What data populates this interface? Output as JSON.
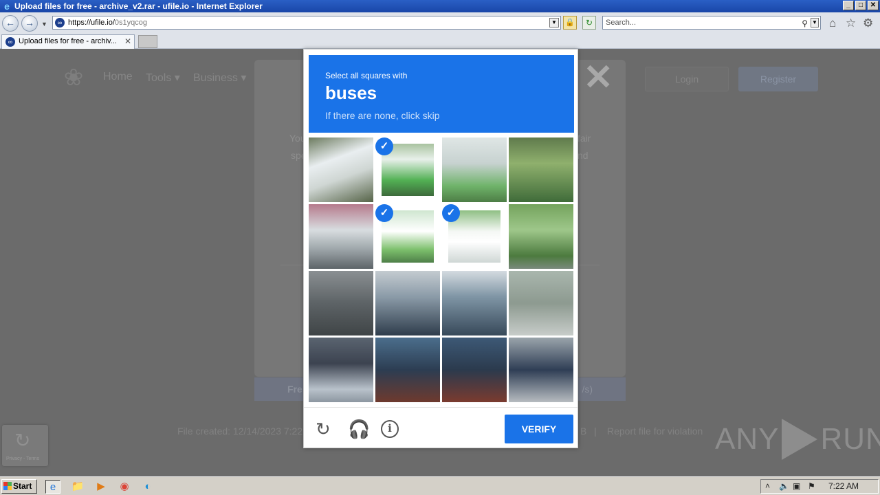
{
  "window": {
    "title": "Upload files for free - archive_v2.rar - ufile.io - Internet Explorer"
  },
  "address_bar": {
    "url_host": "https://ufile.io/",
    "url_path": "0s1yqcog",
    "search_placeholder": "Search..."
  },
  "tab": {
    "label": "Upload files for free - archiv..."
  },
  "site": {
    "nav": [
      "Home",
      "Tools ▾",
      "Business ▾"
    ],
    "login_label": "Login",
    "register_label": "Register",
    "dialog_text_left_1": "You",
    "dialog_text_left_2": "spe",
    "dialog_text_right_1": "fair",
    "dialog_text_right_2": "nd",
    "free_left": "Fre",
    "free_right": "/s)",
    "footer_created": "File created: 12/14/2023 7:22",
    "footer_right_1": "B",
    "footer_sep": "|",
    "footer_report": "Report file for violation",
    "recaptcha_badge_text": "Privacy - Terms"
  },
  "captcha": {
    "instruction": "Select all squares with",
    "target": "buses",
    "hint": "If there are none, click skip",
    "verify_label": "VERIFY",
    "tiles": [
      {
        "selected": false
      },
      {
        "selected": true
      },
      {
        "selected": false
      },
      {
        "selected": false
      },
      {
        "selected": false
      },
      {
        "selected": true
      },
      {
        "selected": true
      },
      {
        "selected": false
      },
      {
        "selected": false
      },
      {
        "selected": false
      },
      {
        "selected": false
      },
      {
        "selected": false
      },
      {
        "selected": false
      },
      {
        "selected": false
      },
      {
        "selected": false
      },
      {
        "selected": false
      }
    ],
    "icons": {
      "reload": "reload-icon",
      "audio": "headphones-icon",
      "info": "info-icon"
    },
    "accent_color": "#1a73e8"
  },
  "watermark": {
    "left": "ANY",
    "right": "RUN"
  },
  "taskbar": {
    "start_label": "Start",
    "clock": "7:22 AM"
  }
}
